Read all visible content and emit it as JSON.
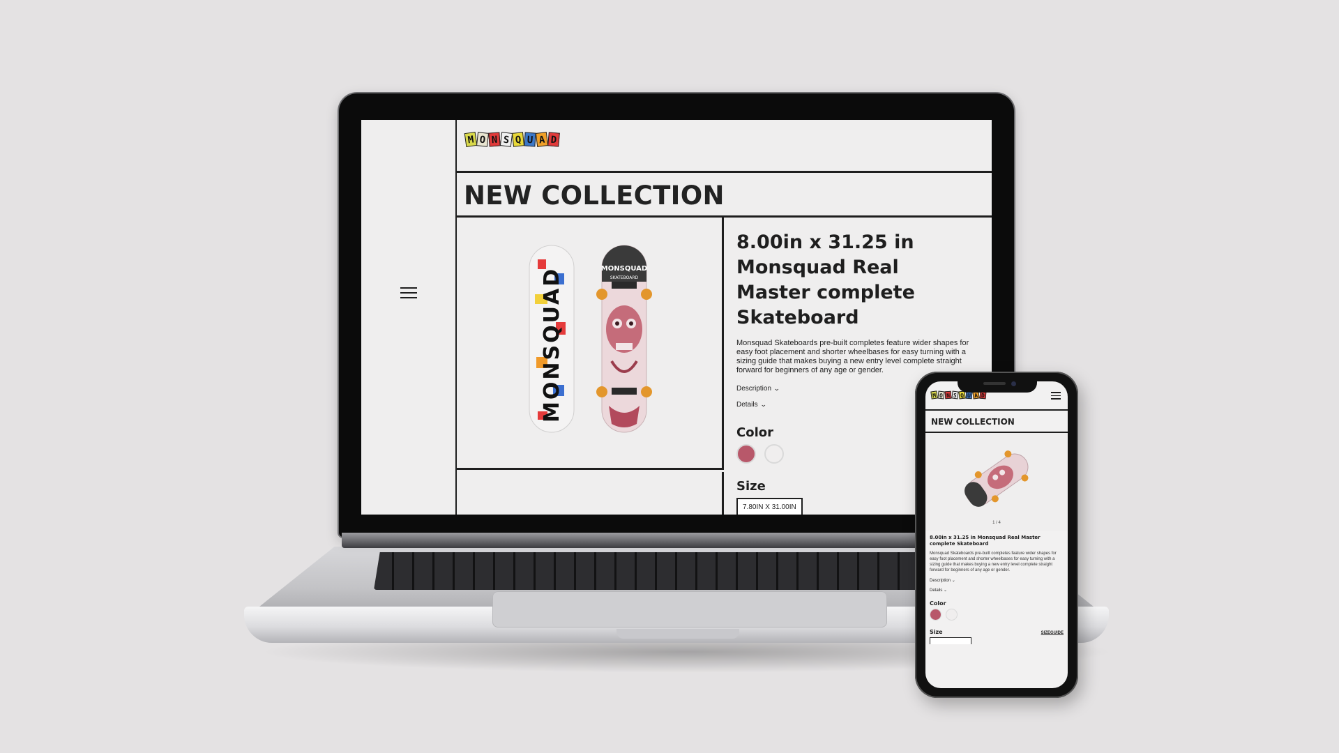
{
  "brand": {
    "logo_letters": [
      "M",
      "O",
      "N",
      "S",
      "Q",
      "U",
      "A",
      "D"
    ],
    "logo_colors": [
      "#d9d94a",
      "#e8e4d0",
      "#e13a3a",
      "#f0f0f0",
      "#e8d838",
      "#3c78c8",
      "#f0a028",
      "#e13a3a"
    ]
  },
  "desktop": {
    "page_title": "NEW COLLECTION",
    "product": {
      "title": "8.00in x 31.25 in Monsquad Real Master complete Skateboard",
      "description": "Monsquad Skateboards pre-built completes feature wider shapes for easy foot placement and shorter wheelbases for easy turning with a sizing guide that makes buying a new entry level complete straight forward for beginners of any age or gender.",
      "accordion_description": "Description",
      "accordion_details": "Details",
      "color_heading": "Color",
      "size_heading": "Size",
      "selected_size": "7.80IN X 31.00IN"
    },
    "deck_text": "MONSQUAD",
    "deck_sub": "SKATEBOARD"
  },
  "mobile": {
    "page_title": "NEW COLLECTION",
    "image_counter": "1 / 4",
    "product": {
      "title": "8.00in x 31.25 in Monsquad Real Master complete Skateboard",
      "description": "Monsquad Skateboards pre-built completes feature wider shapes for easy foot placement and shorter wheelbases for easy turning with a sizing guide that makes buying a new entry level complete straight forward for beginners of any age or gender.",
      "accordion_description": "Description",
      "accordion_details": "Details",
      "color_heading": "Color",
      "size_heading": "Size",
      "size_guide": "SIZEGUIDE"
    }
  },
  "colors": {
    "ink": "#1e1e1e",
    "swatch_pink": "#b8586a",
    "swatch_white": "#f0eeee",
    "background": "#e4e2e3"
  },
  "icons": [
    "hamburger-menu-icon",
    "chevron-down-icon"
  ]
}
